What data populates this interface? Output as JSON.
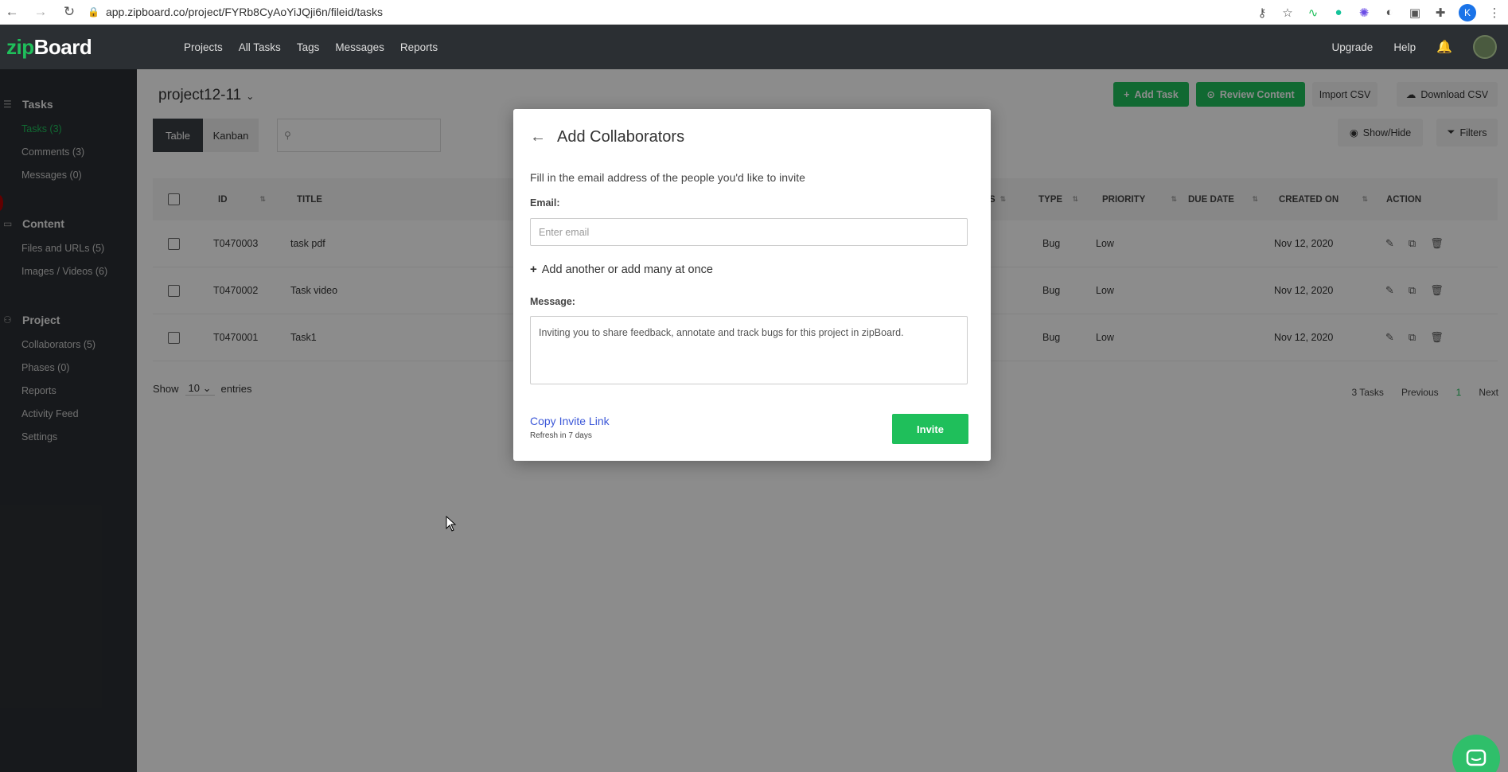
{
  "browser": {
    "url": "app.zipboard.co/project/FYRb8CyAoYiJQji6n/fileid/tasks",
    "profile_initial": "K"
  },
  "header": {
    "logo_zip": "zip",
    "logo_board": "Board",
    "nav": [
      "Projects",
      "All Tasks",
      "Tags",
      "Messages",
      "Reports"
    ],
    "upgrade": "Upgrade",
    "help": "Help"
  },
  "sidebar": {
    "tasks_section": "Tasks",
    "tasks_items": [
      "Tasks (3)",
      "Comments (3)",
      "Messages (0)"
    ],
    "content_section": "Content",
    "content_items": [
      "Files and URLs (5)",
      "Images / Videos (6)"
    ],
    "project_section": "Project",
    "project_items": [
      "Collaborators (5)",
      "Phases (0)",
      "Reports",
      "Activity Feed",
      "Settings"
    ]
  },
  "main": {
    "project_title": "project12-11",
    "add_task": "Add Task",
    "review_content": "Review Content",
    "import_csv": "Import CSV",
    "download_csv": "Download CSV",
    "view_table": "Table",
    "view_kanban": "Kanban",
    "show_hide": "Show/Hide",
    "filters": "Filters",
    "columns": {
      "id": "ID",
      "title": "TITLE",
      "status_fragment": "S",
      "type": "TYPE",
      "priority": "PRIORITY",
      "due_date": "DUE DATE",
      "created_on": "CREATED ON",
      "action": "ACTION"
    },
    "rows": [
      {
        "id": "T0470003",
        "title": "task pdf",
        "type": "Bug",
        "priority": "Low",
        "created": "Nov 12, 2020"
      },
      {
        "id": "T0470002",
        "title": "Task video",
        "type": "Bug",
        "priority": "Low",
        "created": "Nov 12, 2020"
      },
      {
        "id": "T0470001",
        "title": "Task1",
        "type": "Bug",
        "priority": "Low",
        "created": "Nov 12, 2020"
      }
    ],
    "show_label": "Show",
    "entries_value": "10",
    "entries_label": "entries",
    "task_count": "3 Tasks",
    "previous": "Previous",
    "page": "1",
    "next": "Next"
  },
  "modal": {
    "title": "Add Collaborators",
    "description": "Fill in the email address of the people you'd like to invite",
    "email_label": "Email:",
    "email_placeholder": "Enter email",
    "add_another": "Add another or add many at once",
    "message_label": "Message:",
    "message_text": "Inviting you to share feedback, annotate and track bugs for this project in zipBoard.",
    "copy_invite_link": "Copy Invite Link",
    "refresh_note": "Refresh in 7 days",
    "invite_button": "Invite"
  },
  "colors": {
    "brand_green": "#1fbf5b",
    "sidebar_bg": "#2b2f33",
    "link_blue": "#3b57d8"
  }
}
